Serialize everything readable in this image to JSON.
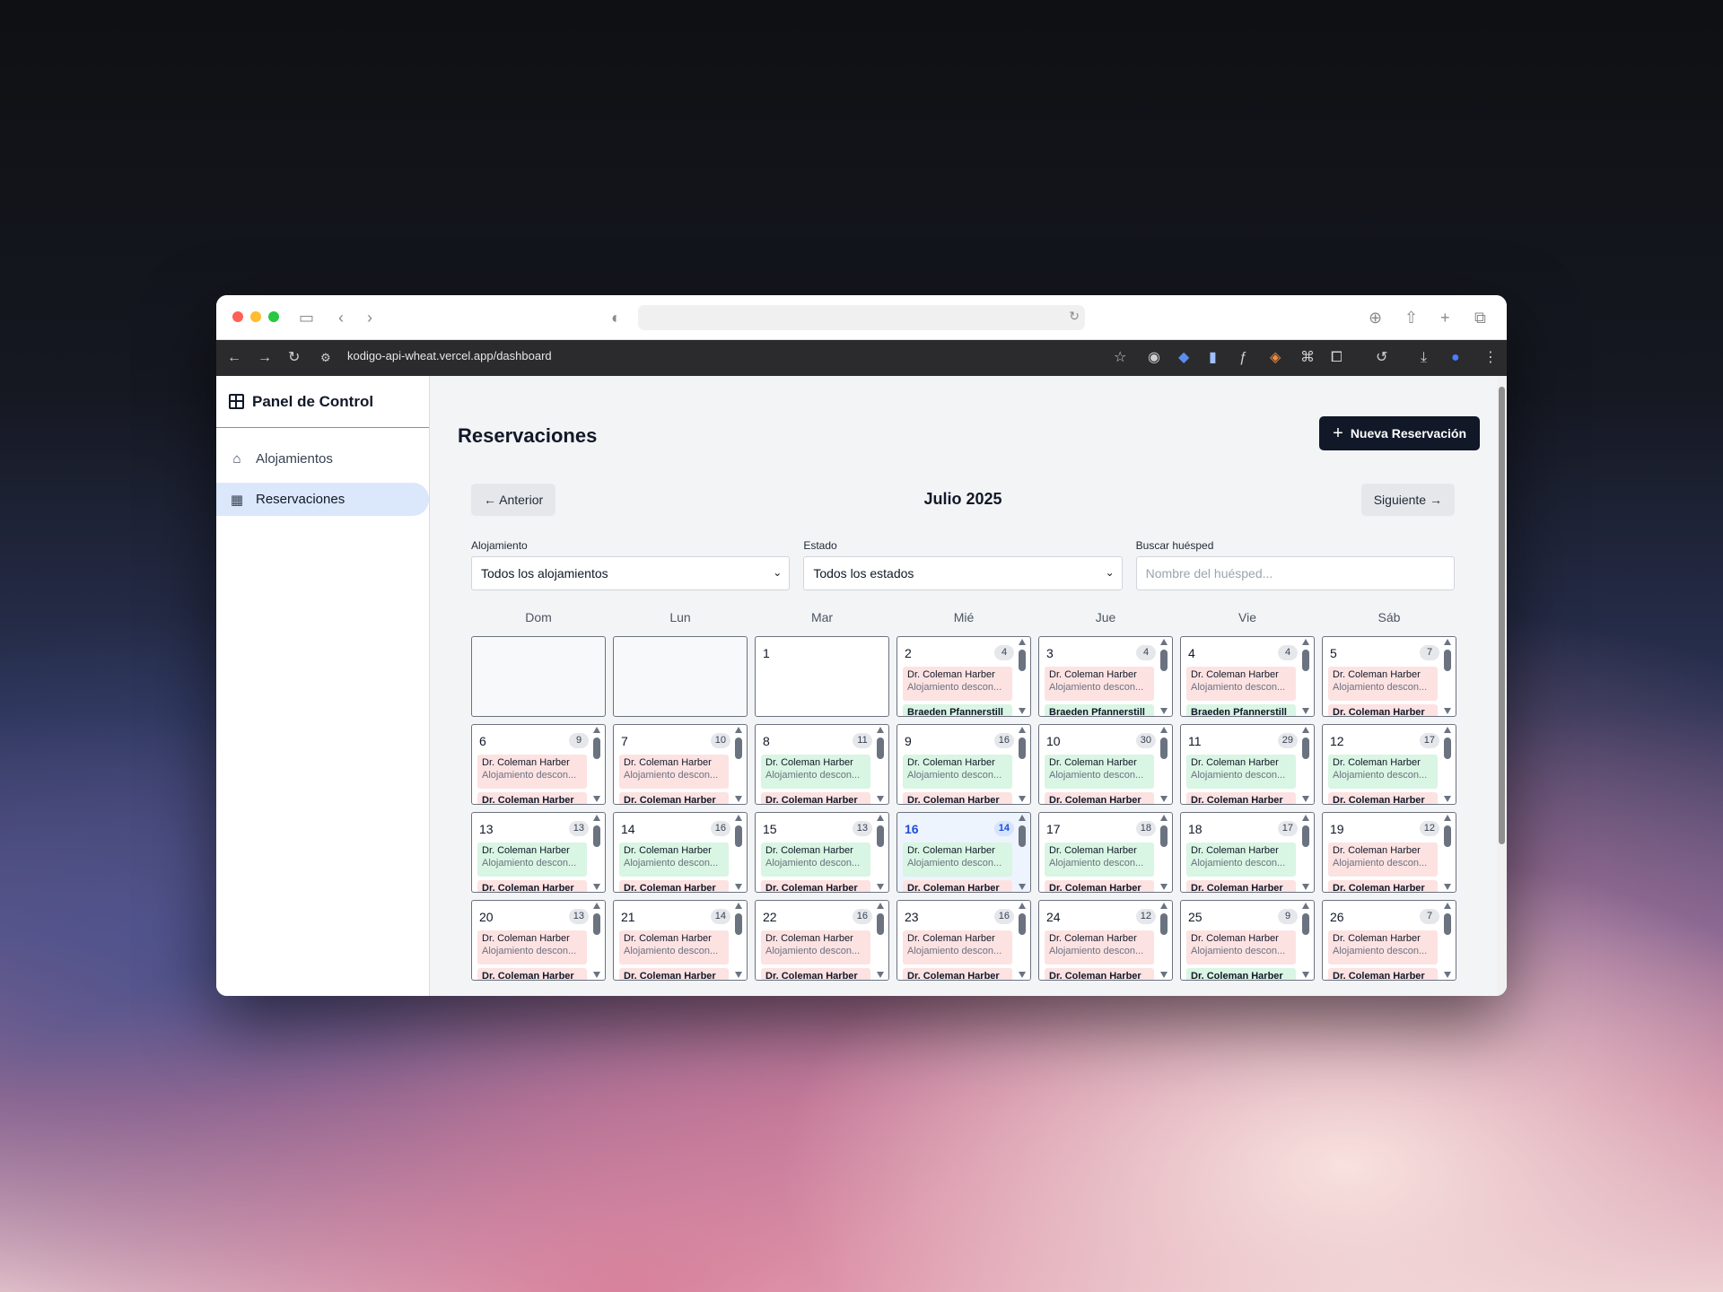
{
  "browser": {
    "url": "kodigo-api-wheat.vercel.app/dashboard"
  },
  "sidebar": {
    "brand": "Panel de Control",
    "items": [
      {
        "label": "Alojamientos",
        "icon": "home-icon",
        "active": false
      },
      {
        "label": "Reservaciones",
        "icon": "calendar-icon",
        "active": true
      }
    ]
  },
  "header": {
    "title": "Reservaciones",
    "new_button": "Nueva Reservación"
  },
  "calendar": {
    "prev": "← Anterior",
    "next": "Siguiente →",
    "month": "Julio 2025",
    "filters": {
      "alojamiento_label": "Alojamiento",
      "alojamiento_value": "Todos los alojamientos",
      "estado_label": "Estado",
      "estado_value": "Todos los estados",
      "buscar_label": "Buscar huésped",
      "buscar_placeholder": "Nombre del huésped..."
    },
    "weekdays": [
      "Dom",
      "Lun",
      "Mar",
      "Mié",
      "Jue",
      "Vie",
      "Sáb"
    ],
    "event_name": "Dr. Coleman Harber",
    "event_sub": "Alojamiento descon...",
    "today": "16",
    "weeks": [
      [
        {
          "day": "",
          "count": ""
        },
        {
          "day": "",
          "count": ""
        },
        {
          "day": "1",
          "count": ""
        },
        {
          "day": "2",
          "count": "4",
          "c1": "red",
          "n2": "Braeden Pfannerstill",
          "c2": "green"
        },
        {
          "day": "3",
          "count": "4",
          "c1": "red",
          "n2": "Braeden Pfannerstill",
          "c2": "green"
        },
        {
          "day": "4",
          "count": "4",
          "c1": "red",
          "n2": "Braeden Pfannerstill",
          "c2": "green"
        },
        {
          "day": "5",
          "count": "7",
          "c1": "red",
          "n2": "Dr. Coleman Harber",
          "c2": "red"
        }
      ],
      [
        {
          "day": "6",
          "count": "9",
          "c1": "red",
          "n2": "Dr. Coleman Harber",
          "c2": "red"
        },
        {
          "day": "7",
          "count": "10",
          "c1": "red",
          "n2": "Dr. Coleman Harber",
          "c2": "red"
        },
        {
          "day": "8",
          "count": "11",
          "c1": "green",
          "n2": "Dr. Coleman Harber",
          "c2": "red"
        },
        {
          "day": "9",
          "count": "16",
          "c1": "green",
          "n2": "Dr. Coleman Harber",
          "c2": "red"
        },
        {
          "day": "10",
          "count": "30",
          "c1": "green",
          "n2": "Dr. Coleman Harber",
          "c2": "red"
        },
        {
          "day": "11",
          "count": "29",
          "c1": "green",
          "n2": "Dr. Coleman Harber",
          "c2": "red"
        },
        {
          "day": "12",
          "count": "17",
          "c1": "green",
          "n2": "Dr. Coleman Harber",
          "c2": "red"
        }
      ],
      [
        {
          "day": "13",
          "count": "13",
          "c1": "green",
          "n2": "Dr. Coleman Harber",
          "c2": "red"
        },
        {
          "day": "14",
          "count": "16",
          "c1": "green",
          "n2": "Dr. Coleman Harber",
          "c2": "red"
        },
        {
          "day": "15",
          "count": "13",
          "c1": "green",
          "n2": "Dr. Coleman Harber",
          "c2": "red"
        },
        {
          "day": "16",
          "count": "14",
          "c1": "green",
          "n2": "Dr. Coleman Harber",
          "c2": "red"
        },
        {
          "day": "17",
          "count": "18",
          "c1": "green",
          "n2": "Dr. Coleman Harber",
          "c2": "red"
        },
        {
          "day": "18",
          "count": "17",
          "c1": "green",
          "n2": "Dr. Coleman Harber",
          "c2": "red"
        },
        {
          "day": "19",
          "count": "12",
          "c1": "red",
          "n2": "Dr. Coleman Harber",
          "c2": "red"
        }
      ],
      [
        {
          "day": "20",
          "count": "13",
          "c1": "red",
          "n2": "Dr. Coleman Harber",
          "c2": "red"
        },
        {
          "day": "21",
          "count": "14",
          "c1": "red",
          "n2": "Dr. Coleman Harber",
          "c2": "red"
        },
        {
          "day": "22",
          "count": "16",
          "c1": "red",
          "n2": "Dr. Coleman Harber",
          "c2": "red"
        },
        {
          "day": "23",
          "count": "16",
          "c1": "red",
          "n2": "Dr. Coleman Harber",
          "c2": "red"
        },
        {
          "day": "24",
          "count": "12",
          "c1": "red",
          "n2": "Dr. Coleman Harber",
          "c2": "red"
        },
        {
          "day": "25",
          "count": "9",
          "c1": "red",
          "n2": "Dr. Coleman Harber",
          "c2": "green"
        },
        {
          "day": "26",
          "count": "7",
          "c1": "red",
          "n2": "Dr. Coleman Harber",
          "c2": "red"
        }
      ]
    ]
  },
  "colors": {
    "event_red": "#fde2e2",
    "event_green": "#d9f5e3",
    "primary_button": "#111827",
    "today_accent": "#1d4ed8"
  }
}
